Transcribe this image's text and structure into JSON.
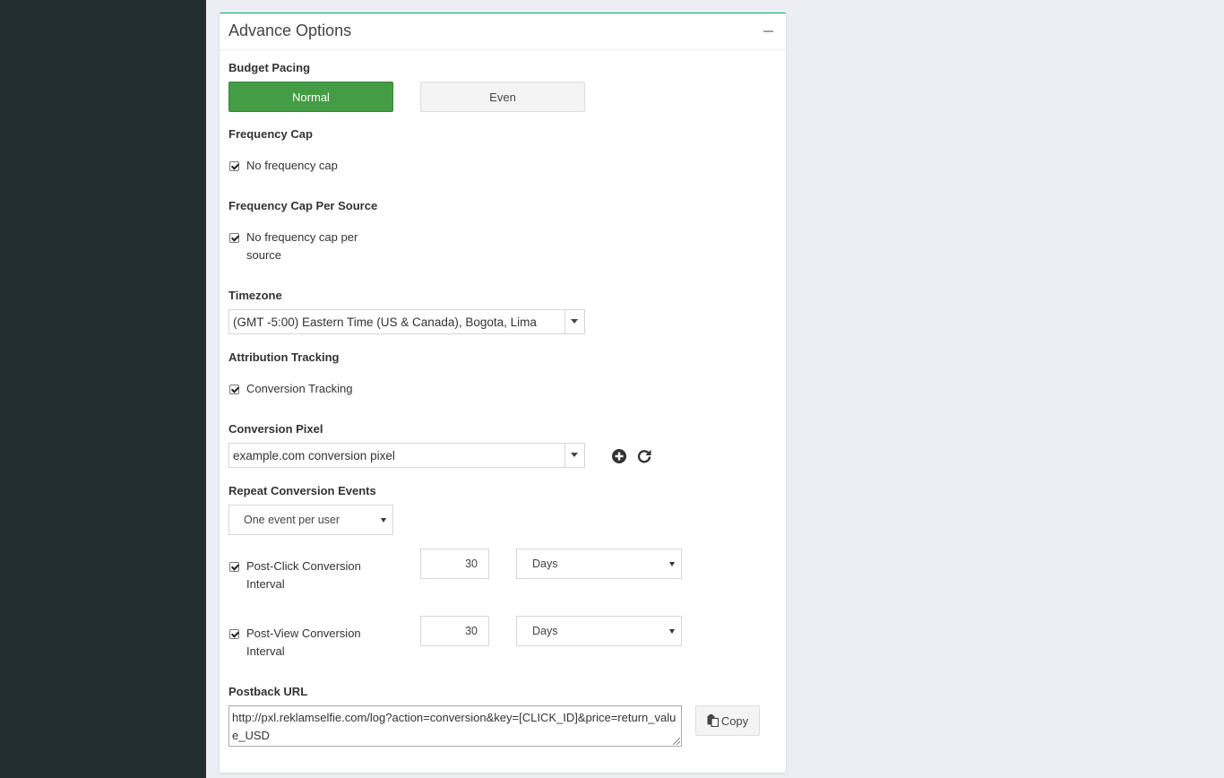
{
  "panel": {
    "title": "Advance Options"
  },
  "budget_pacing": {
    "label": "Budget Pacing",
    "options": [
      "Normal",
      "Even"
    ],
    "selected": "Normal"
  },
  "frequency_cap": {
    "label": "Frequency Cap",
    "checkbox_label": "No frequency cap",
    "checked": true
  },
  "frequency_cap_source": {
    "label": "Frequency Cap Per Source",
    "checkbox_label": "No frequency cap per source",
    "checked": true
  },
  "timezone": {
    "label": "Timezone",
    "value": "(GMT -5:00) Eastern Time (US & Canada), Bogota, Lima"
  },
  "attribution": {
    "label": "Attribution Tracking",
    "checkbox_label": "Conversion Tracking",
    "checked": true
  },
  "conversion_pixel": {
    "label": "Conversion Pixel",
    "value": "example.com conversion pixel",
    "add_icon": "plus-circle-icon",
    "refresh_icon": "refresh-icon"
  },
  "repeat_events": {
    "label": "Repeat Conversion Events",
    "value": "One event per user"
  },
  "post_click": {
    "checkbox_label": "Post-Click Conversion Interval",
    "checked": true,
    "value": "30",
    "unit": "Days"
  },
  "post_view": {
    "checkbox_label": "Post-View Conversion Interval",
    "checked": true,
    "value": "30",
    "unit": "Days"
  },
  "postback": {
    "label": "Postback URL",
    "value": "http://pxl.reklamselfie.com/log?action=conversion&key=[CLICK_ID]&price=return_value_USD",
    "copy_label": "Copy",
    "copy_icon": "clipboard-icon"
  },
  "colors": {
    "accent": "#449d44",
    "sidebar": "#222d32",
    "background": "#eceef3"
  }
}
